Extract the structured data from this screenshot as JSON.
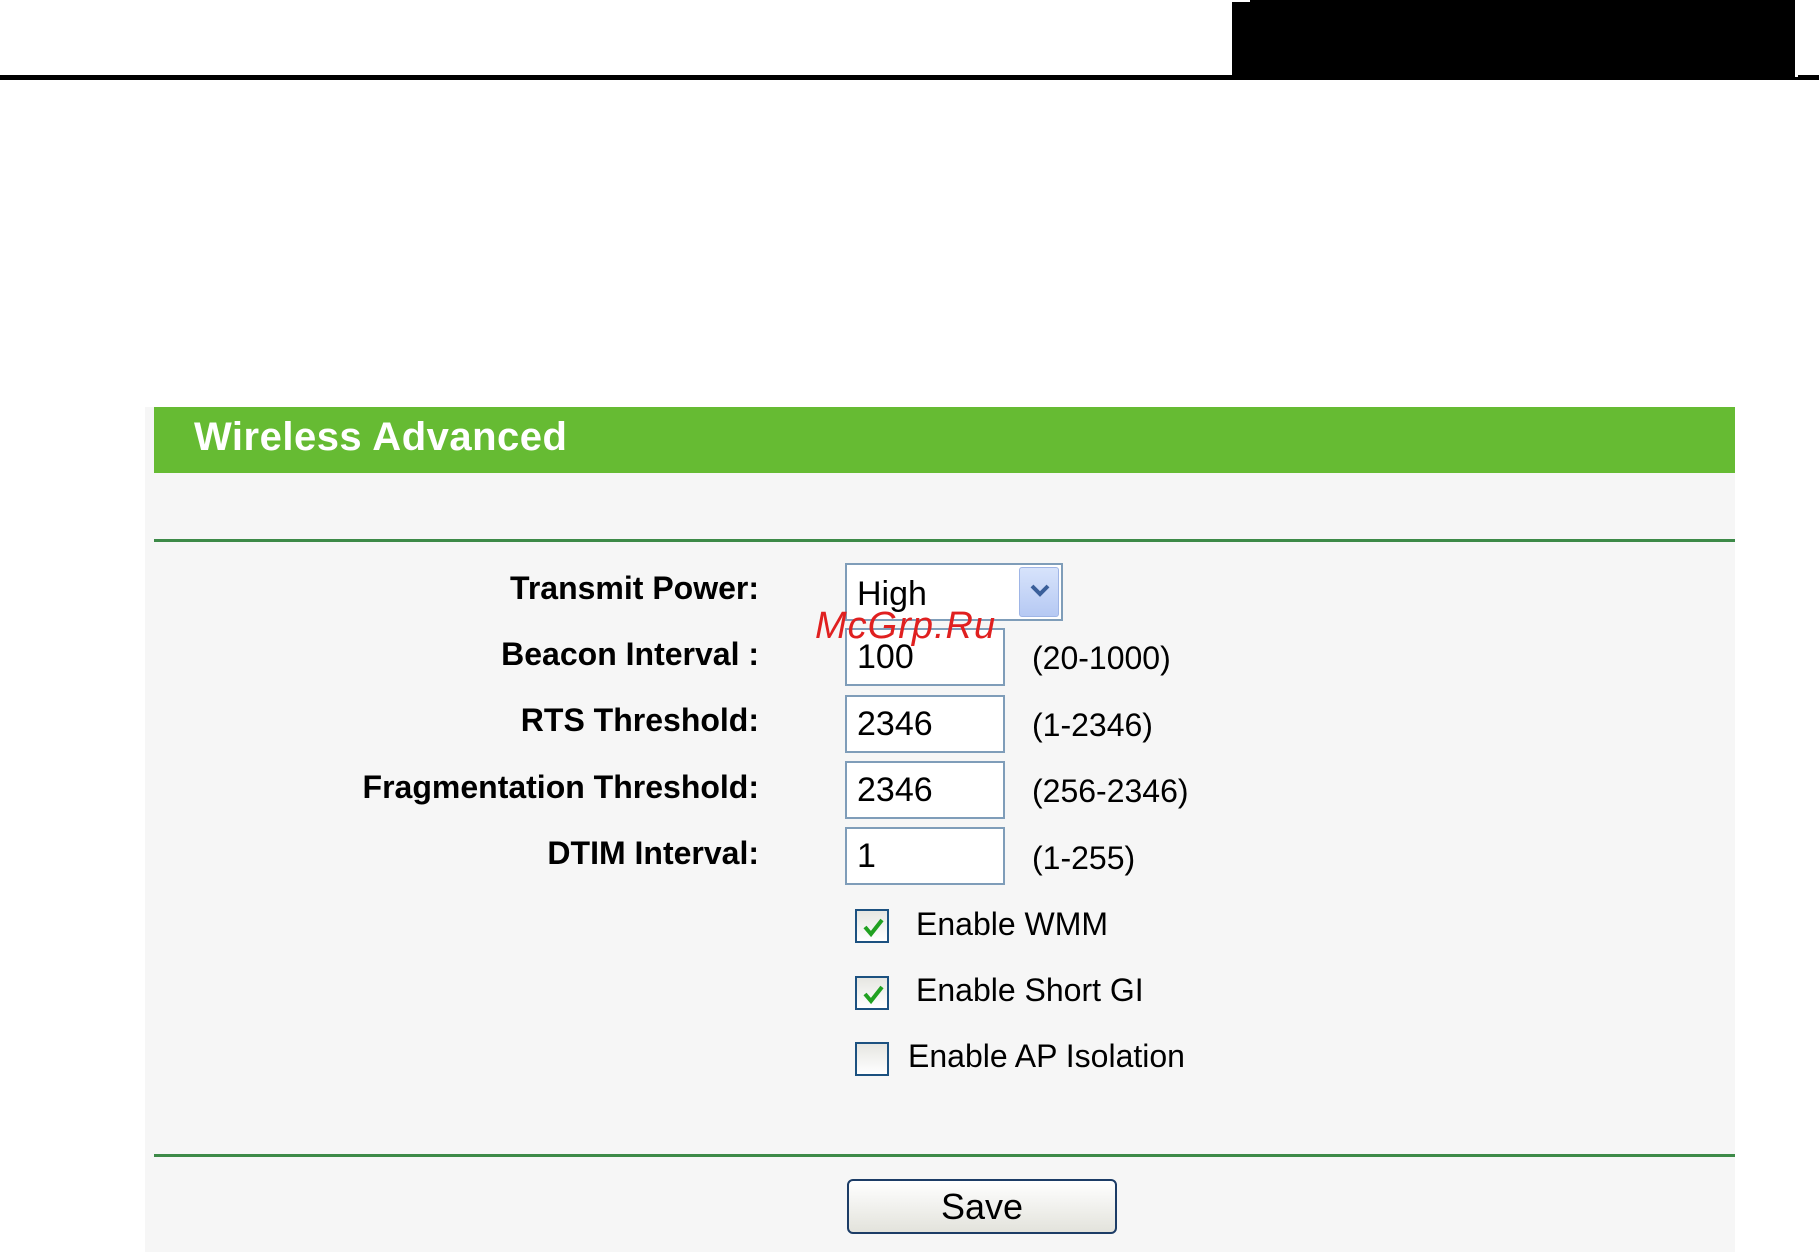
{
  "page": {
    "title": "Wireless Advanced"
  },
  "fields": {
    "transmit_power": {
      "label": "Transmit Power:",
      "value": "High"
    },
    "beacon_interval": {
      "label": "Beacon Interval :",
      "value": "100",
      "hint": "(20-1000)"
    },
    "rts_threshold": {
      "label": "RTS Threshold:",
      "value": "2346",
      "hint": "(1-2346)"
    },
    "fragmentation_threshold": {
      "label": "Fragmentation Threshold:",
      "value": "2346",
      "hint": "(256-2346)"
    },
    "dtim_interval": {
      "label": "DTIM Interval:",
      "value": "1",
      "hint": "(1-255)"
    }
  },
  "options": [
    {
      "label": "Enable WMM",
      "checked": true
    },
    {
      "label": "Enable Short GI",
      "checked": true
    },
    {
      "label": "Enable AP Isolation",
      "checked": false
    }
  ],
  "actions": {
    "save_label": "Save"
  },
  "watermark": {
    "text": "McGrp.Ru"
  },
  "colors": {
    "header_green": "#66bb33",
    "rule_green": "#3d8a48",
    "check_green": "#21a121",
    "watermark_red": "#e02020"
  },
  "icons": {
    "select_arrow": "chevron-down-icon",
    "check": "checkmark-icon"
  }
}
